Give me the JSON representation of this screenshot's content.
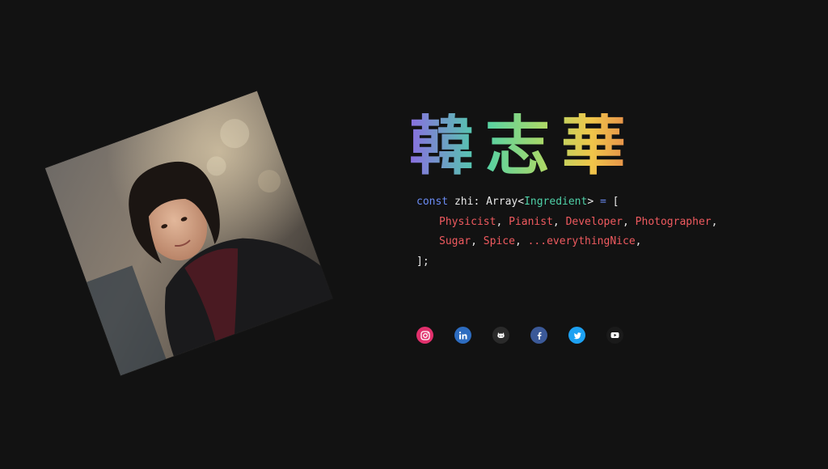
{
  "profile": {
    "name": "韓志華",
    "photo_alt": "Portrait photo"
  },
  "code": {
    "line1_kw": "const",
    "line1_ident": " zhi: Array<",
    "line1_type": "Ingredient",
    "line1_close": ">",
    "line1_eq": " = ",
    "line1_bracket": "[",
    "line2_items": [
      "Physicist",
      "Pianist",
      "Developer",
      "Photographer"
    ],
    "line3_items": [
      "Sugar",
      "Spice",
      "...everythingNice"
    ],
    "line4": "];"
  },
  "socials": [
    {
      "name": "instagram",
      "color": "#e1306c"
    },
    {
      "name": "linkedin",
      "color": "#2d6cc0"
    },
    {
      "name": "github",
      "color": "#2a2a2a"
    },
    {
      "name": "facebook",
      "color": "#3b5998"
    },
    {
      "name": "twitter",
      "color": "#1da1f2"
    },
    {
      "name": "youtube",
      "color": "#1a1a1a"
    }
  ],
  "colors": {
    "background": "#121212",
    "keyword": "#6b8cf5",
    "type": "#4fd1a8",
    "string": "#ef5a5f"
  }
}
